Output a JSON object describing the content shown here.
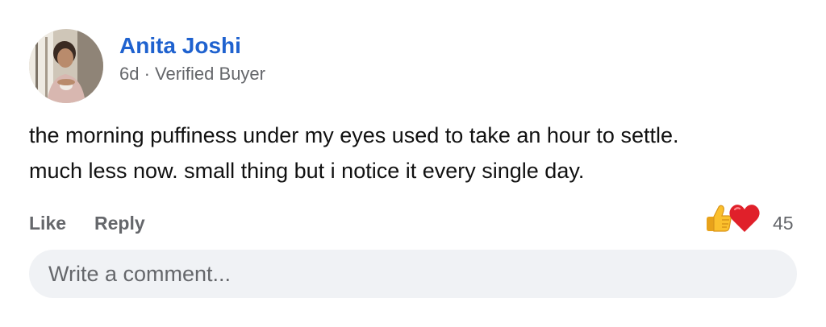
{
  "comment": {
    "author": "Anita Joshi",
    "meta": "6d · Verified Buyer",
    "text_lines": [
      "the morning puffiness under my eyes used to take an hour to settle.",
      "much less now. small thing but i notice it every single day."
    ]
  },
  "actions": {
    "like_label": "Like",
    "reply_label": "Reply"
  },
  "reactions": {
    "types": [
      "thumbs-up-icon",
      "heart-icon"
    ],
    "count": "45"
  },
  "composer": {
    "placeholder": "Write a comment..."
  },
  "colors": {
    "author_name": "#1f62cf",
    "muted_text": "#65676b",
    "body_text": "#111111",
    "composer_bg": "#f0f2f5"
  }
}
